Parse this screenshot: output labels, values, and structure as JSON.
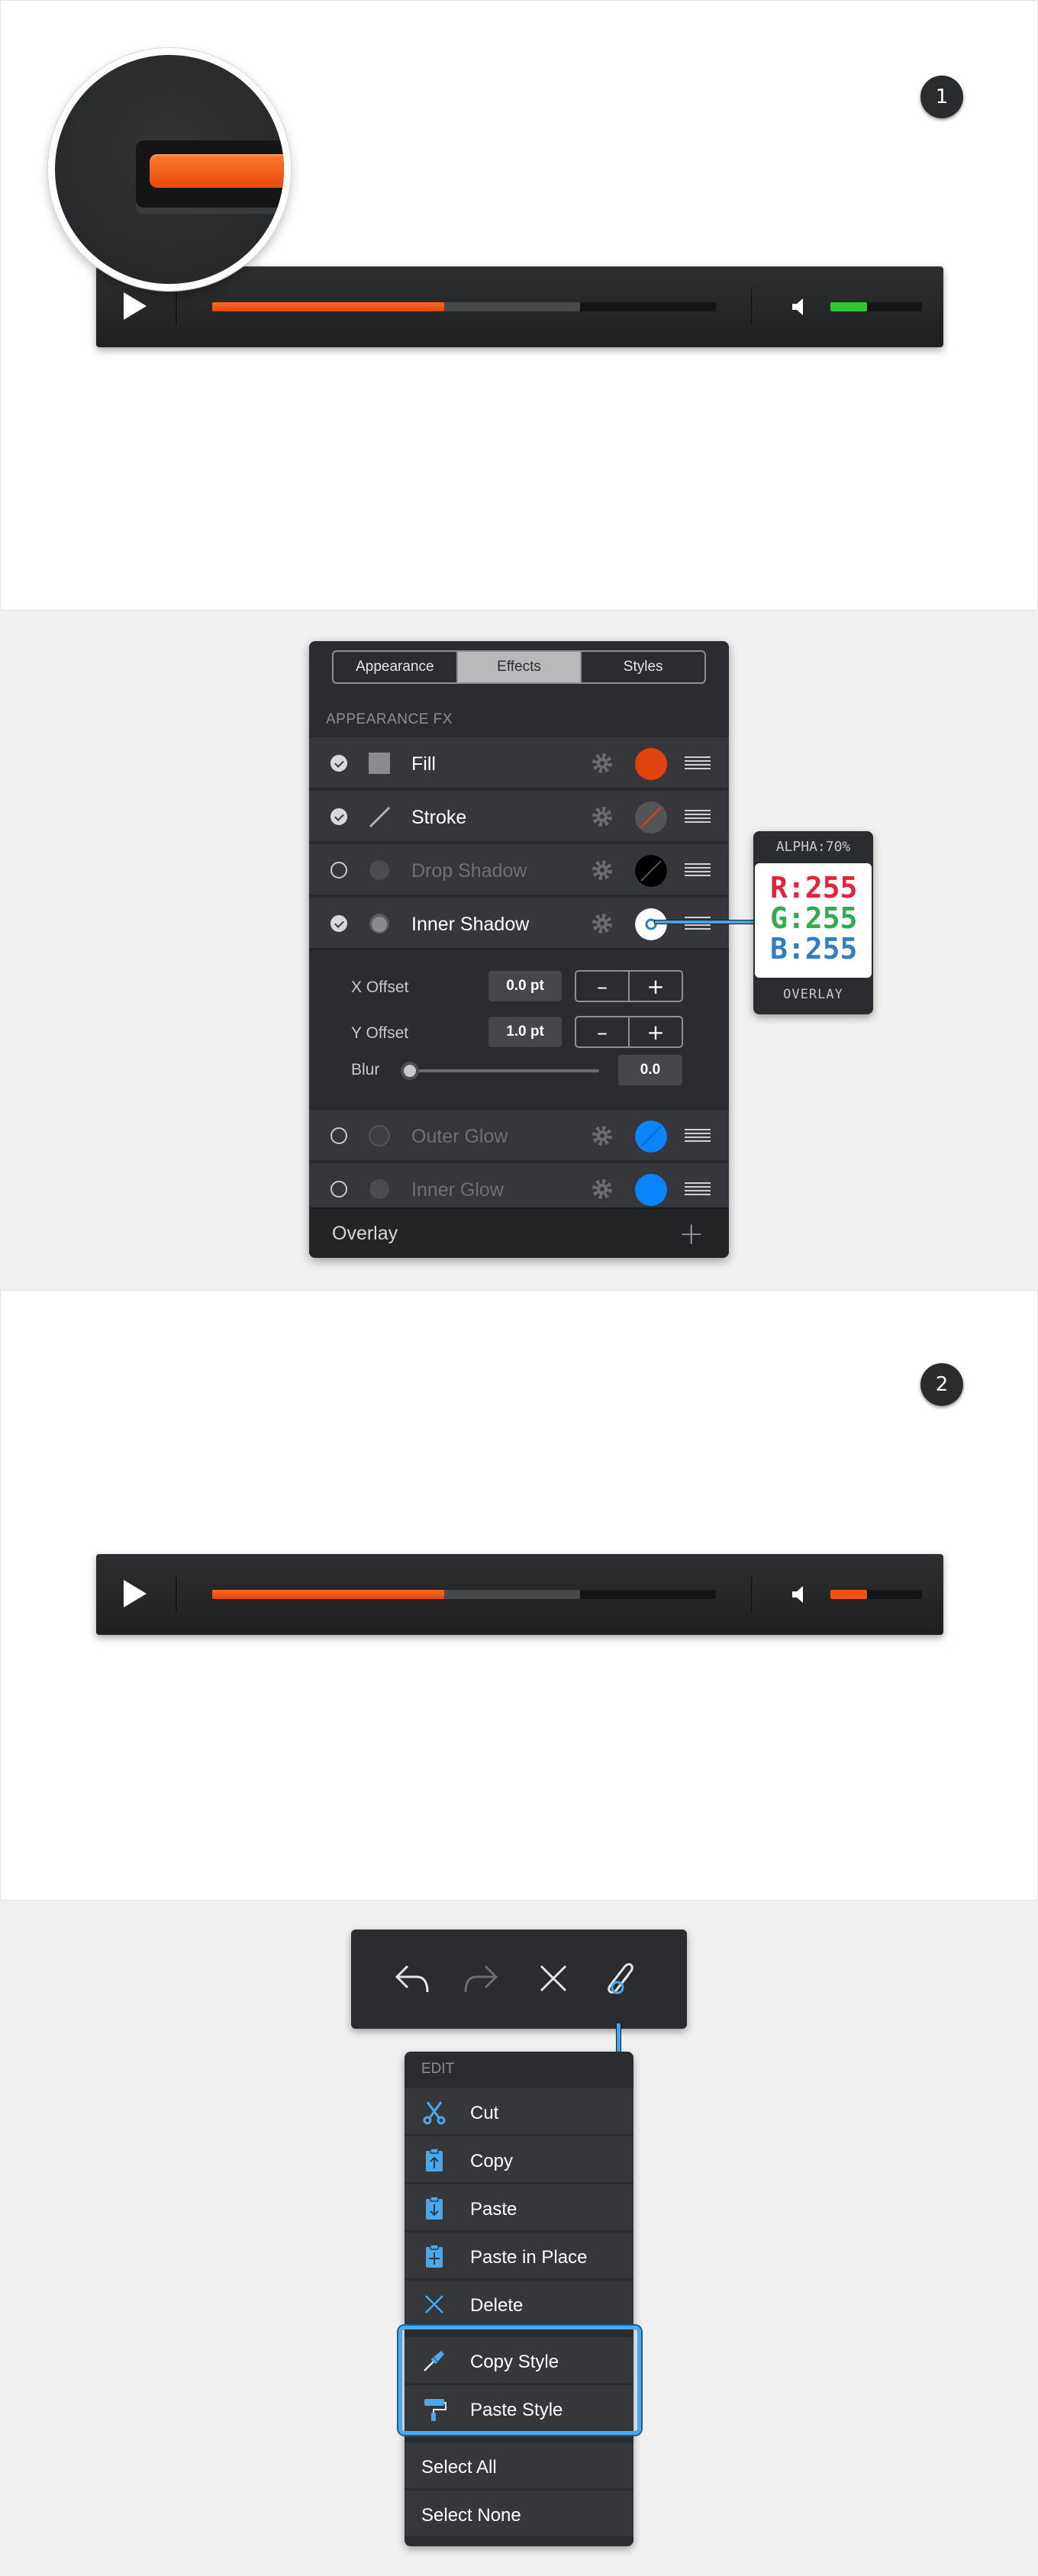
{
  "steps": {
    "step1": "1",
    "step2": "2"
  },
  "player1": {
    "progress": 0.46,
    "buffered": 0.73,
    "volume": 0.4,
    "volume_color": "#2fc832"
  },
  "player2": {
    "progress": 0.46,
    "buffered": 0.73,
    "volume": 0.4,
    "volume_color": "#ef5312"
  },
  "appearance_panel": {
    "tabs": [
      "Appearance",
      "Effects",
      "Styles"
    ],
    "active_tab": "Effects",
    "section_label": "APPEARANCE FX",
    "effects": [
      {
        "name": "Fill",
        "enabled": true,
        "swatch": "#e0440c"
      },
      {
        "name": "Stroke",
        "enabled": true,
        "swatch": "#555558"
      },
      {
        "name": "Drop Shadow",
        "enabled": false,
        "swatch": "#000000"
      },
      {
        "name": "Inner Shadow",
        "enabled": true,
        "swatch": "#ffffff"
      },
      {
        "name": "Outer Glow",
        "enabled": false,
        "swatch": "#0a84ff"
      },
      {
        "name": "Inner Glow",
        "enabled": false,
        "swatch": "#0a84ff"
      }
    ],
    "inner_shadow_settings": {
      "x_offset_label": "X Offset",
      "x_offset_value": "0.0 pt",
      "y_offset_label": "Y Offset",
      "y_offset_value": "1.0 pt",
      "blur_label": "Blur",
      "blur_value": "0.0",
      "minus": "–",
      "plus": "+"
    },
    "blend_mode": "Overlay",
    "add": "+"
  },
  "color_tooltip": {
    "alpha": "ALPHA:70%",
    "r": "R:255",
    "g": "G:255",
    "b": "B:255",
    "blend": "OVERLAY",
    "colors": {
      "r": "#e5233a",
      "g": "#2fae4d",
      "b": "#2f7ec6"
    }
  },
  "toolbar": {
    "buttons": [
      "undo-icon",
      "redo-icon",
      "close-icon",
      "paperclip-icon"
    ]
  },
  "edit_menu": {
    "header": "EDIT",
    "items": [
      {
        "label": "Cut",
        "icon": "scissors-icon"
      },
      {
        "label": "Copy",
        "icon": "copy-clipboard-icon"
      },
      {
        "label": "Paste",
        "icon": "paste-clipboard-icon"
      },
      {
        "label": "Paste in Place",
        "icon": "paste-in-place-icon"
      },
      {
        "label": "Delete",
        "icon": "delete-x-icon"
      },
      {
        "label": "Copy Style",
        "icon": "eyedropper-icon"
      },
      {
        "label": "Paste Style",
        "icon": "paint-roller-icon"
      },
      {
        "label": "Select All"
      },
      {
        "label": "Select None"
      }
    ]
  },
  "accent_color": "#4aa8ee"
}
